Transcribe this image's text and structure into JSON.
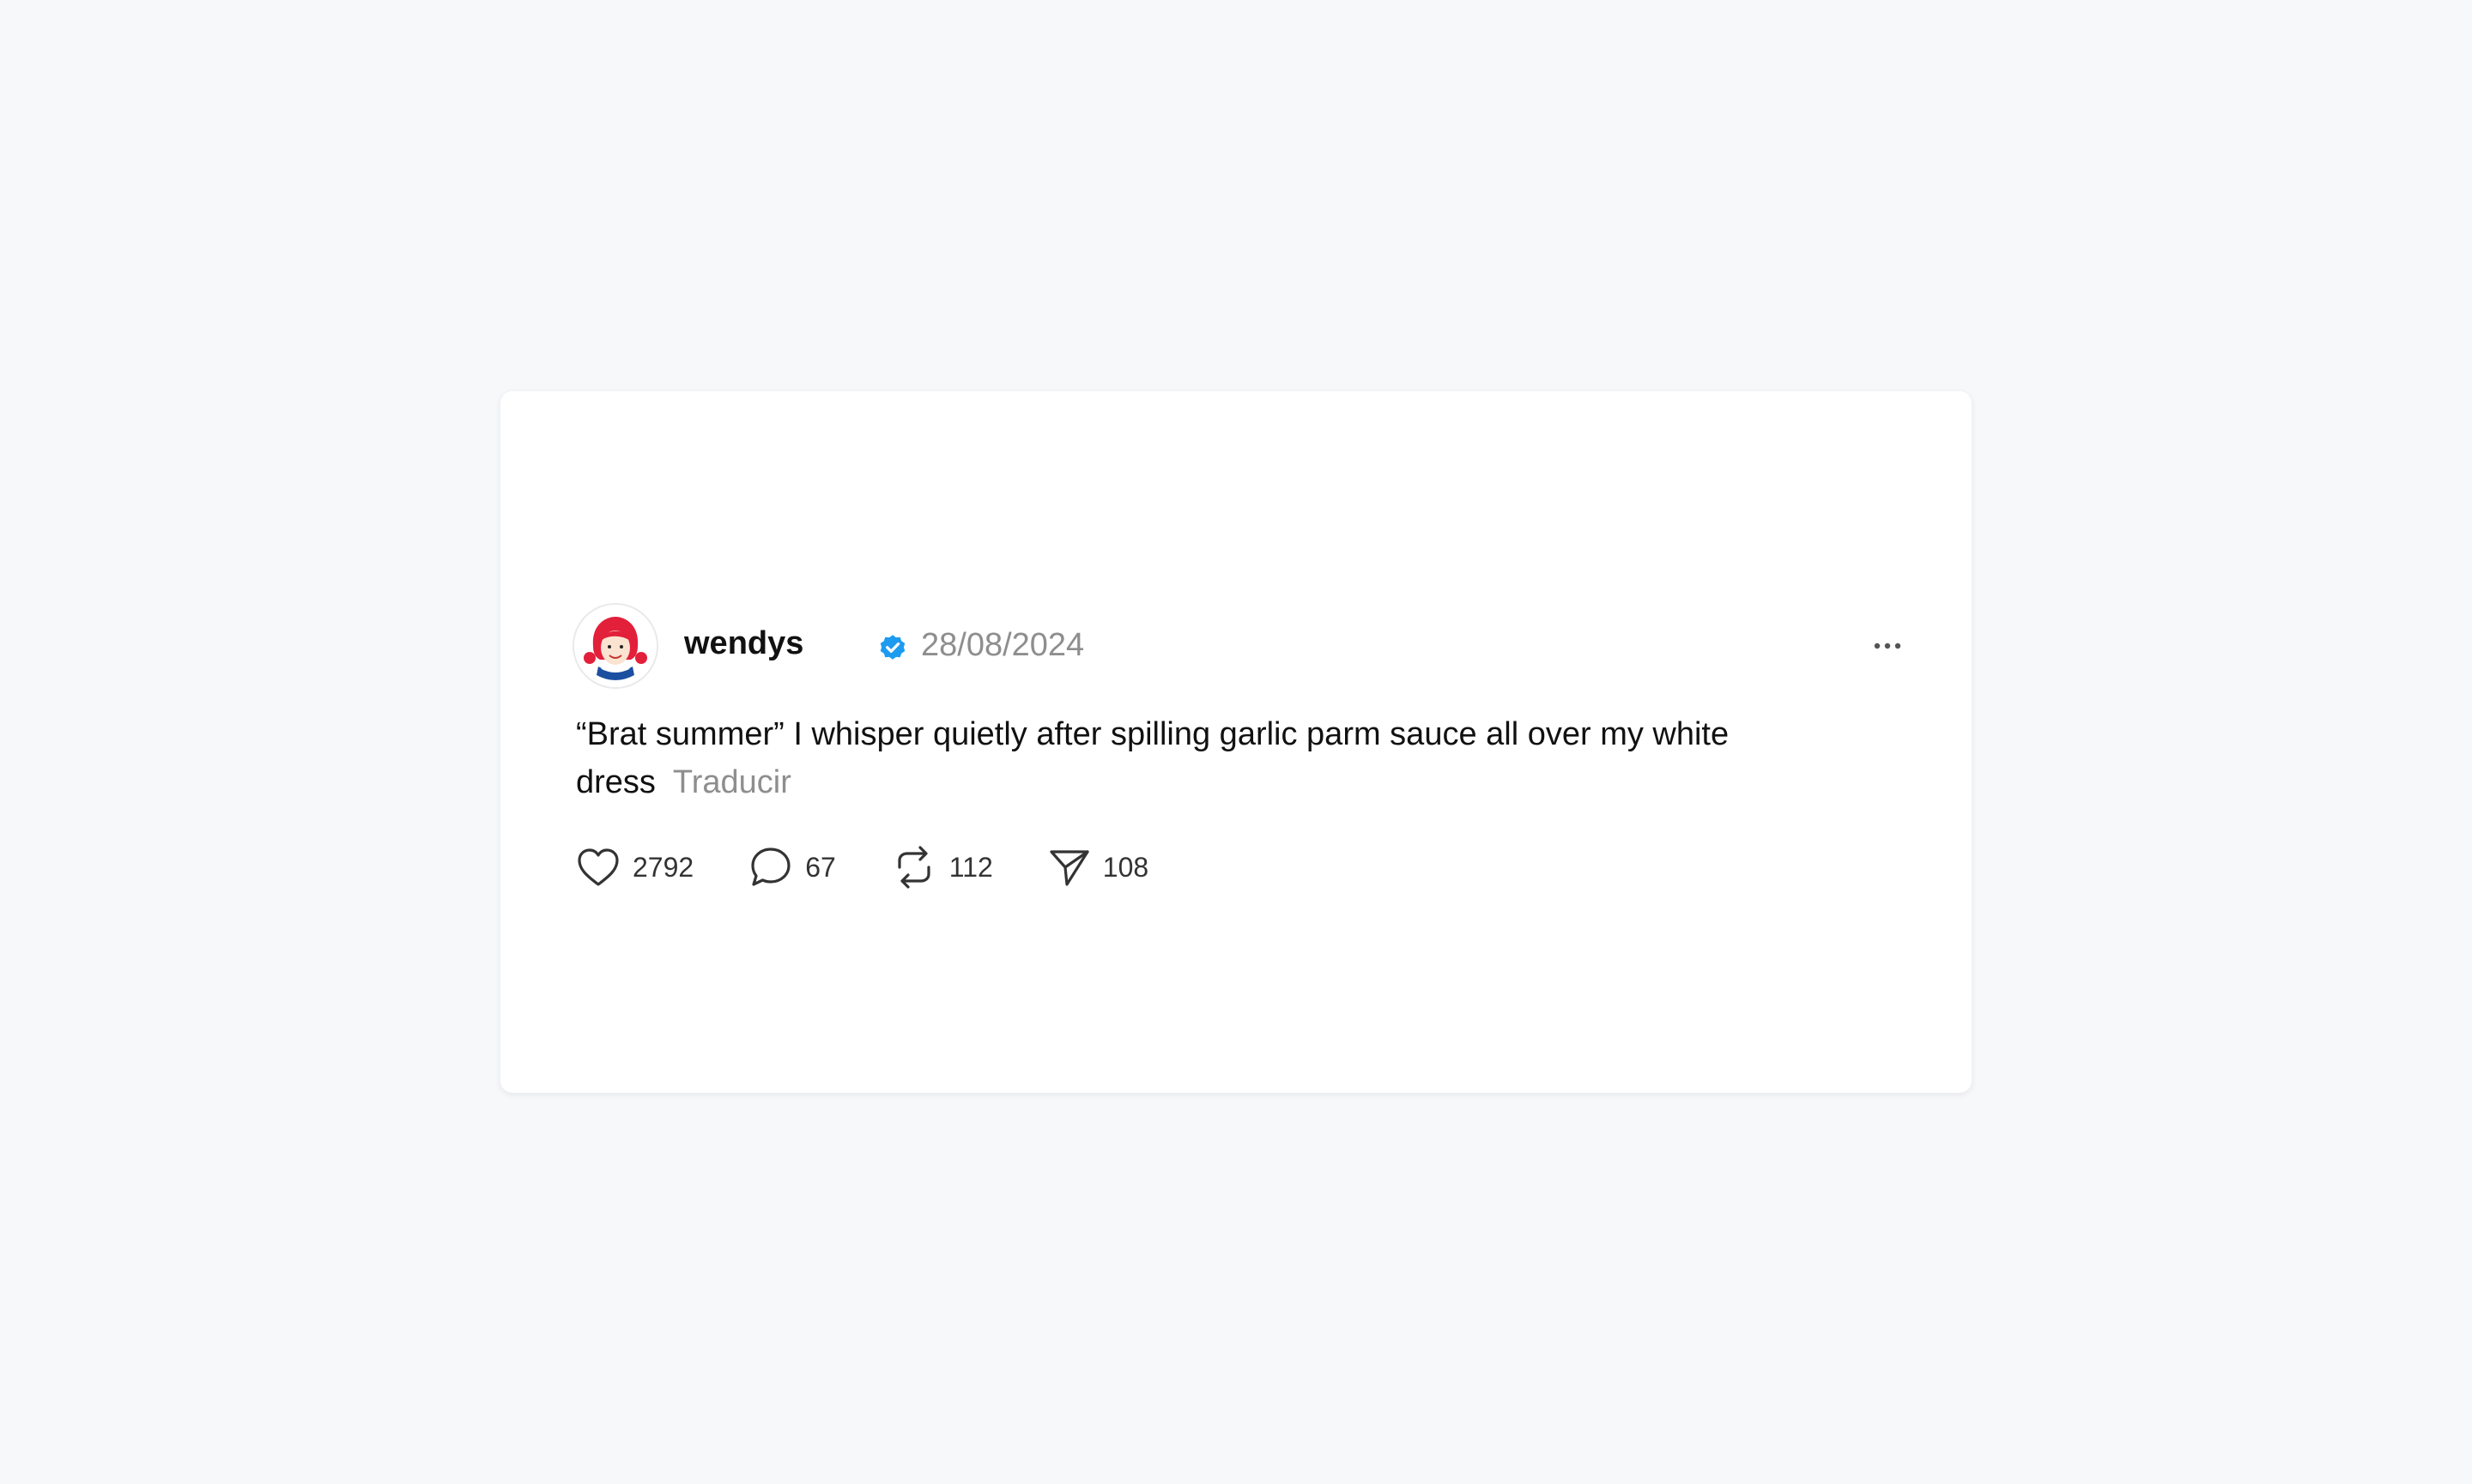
{
  "post": {
    "username": "wendys",
    "date": "28/08/2024",
    "text": "“Brat summer” I whisper quietly after spilling garlic parm sauce all over my white dress",
    "translate_label": "Traducir",
    "stats": {
      "likes": "2792",
      "comments": "67",
      "reposts": "112",
      "shares": "108"
    }
  },
  "icons": {
    "avatar": "wendys-logo-avatar",
    "verified": "verified-badge-icon",
    "more": "more-options-icon",
    "like": "heart-icon",
    "comment": "comment-bubble-icon",
    "repost": "repost-icon",
    "share": "send-icon"
  },
  "colors": {
    "verified": "#1d9bf0",
    "muted_text": "#8e8e8e",
    "avatar_red": "#e2203a"
  }
}
